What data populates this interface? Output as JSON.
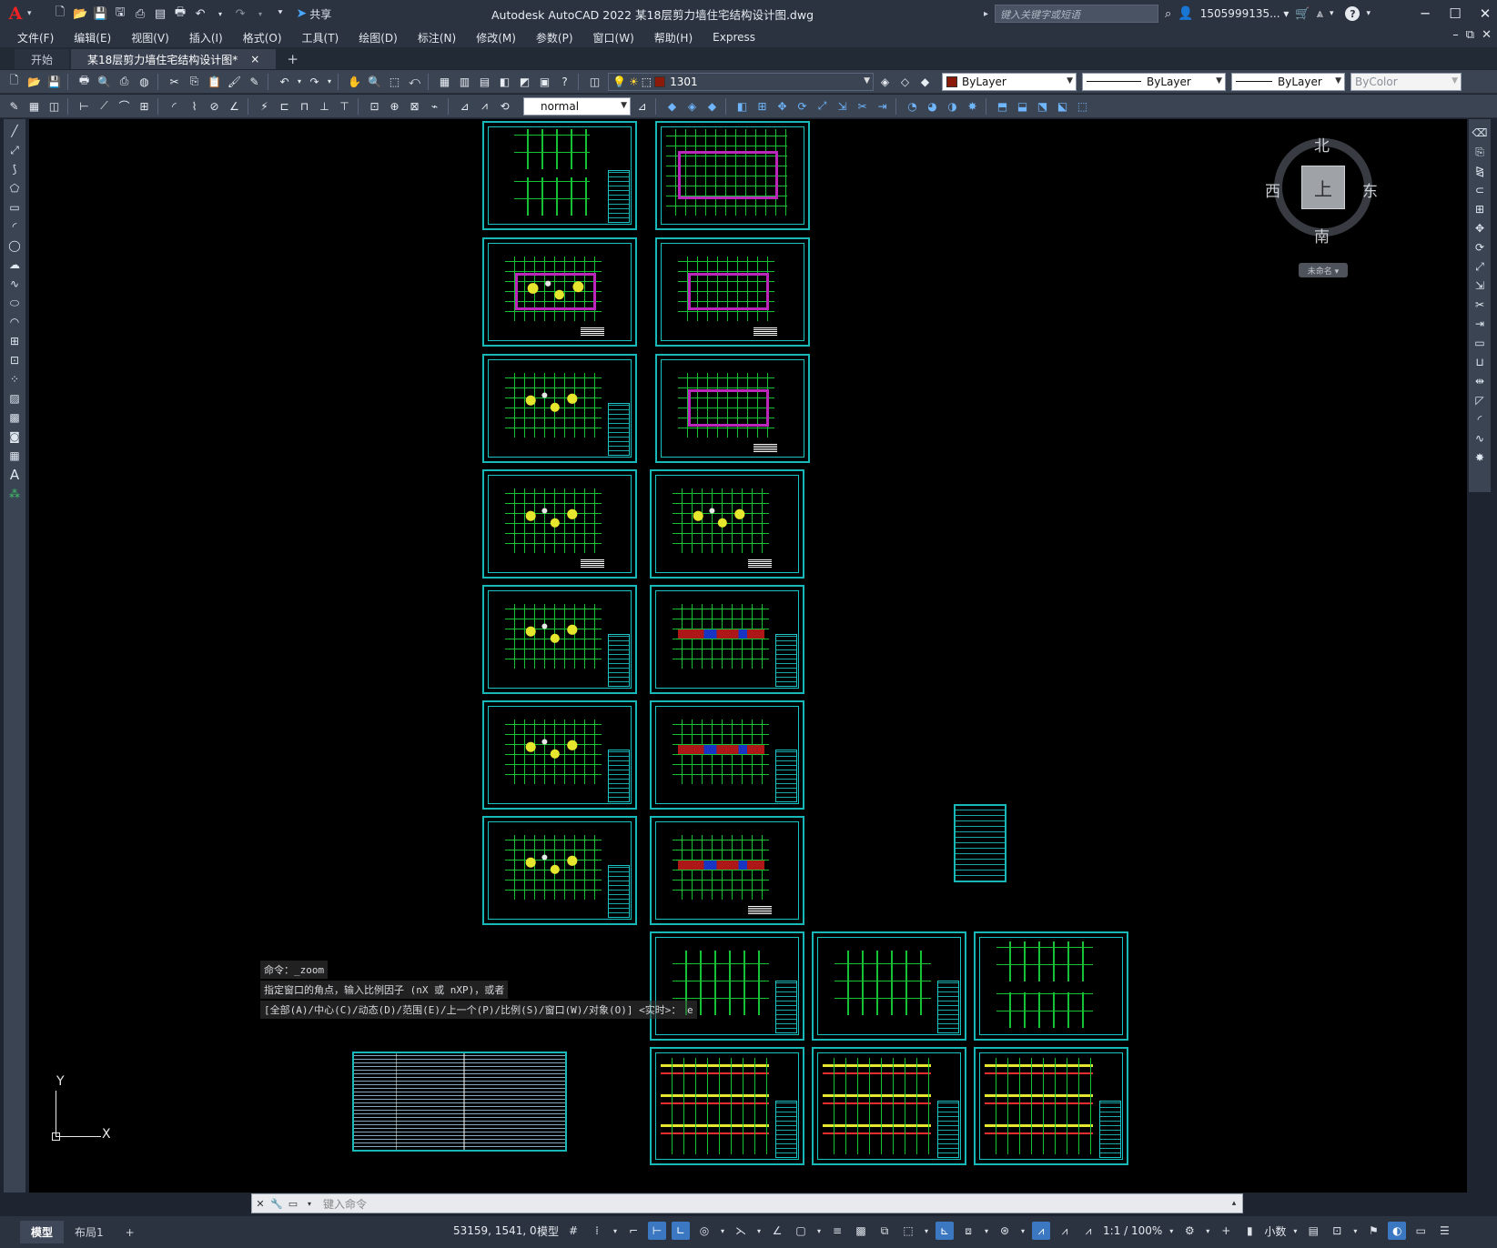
{
  "app": {
    "title": "Autodesk AutoCAD 2022    某18层剪力墙住宅结构设计图.dwg",
    "logo": "A",
    "share_label": "共享",
    "search_placeholder": "键入关键字或短语",
    "user": "1505999135... ▾",
    "help": "?"
  },
  "menu": [
    "文件(F)",
    "编辑(E)",
    "视图(V)",
    "插入(I)",
    "格式(O)",
    "工具(T)",
    "绘图(D)",
    "标注(N)",
    "修改(M)",
    "参数(P)",
    "窗口(W)",
    "帮助(H)",
    "Express"
  ],
  "tabs": {
    "start": "开始",
    "doc": "某18层剪力墙住宅结构设计图*",
    "close": "×",
    "add": "+"
  },
  "toolbar": {
    "layer_value": "1301",
    "layer_color": "#8b1a0a",
    "color_value": "ByLayer",
    "linetype_value": "ByLayer",
    "lineweight_value": "ByLayer",
    "plotstyle_value": "ByColor",
    "textstyle_value": "normal"
  },
  "viewcube": {
    "north": "北",
    "south": "南",
    "east": "东",
    "west": "西",
    "top": "上",
    "wcs": "未命名 ▾"
  },
  "ucs": {
    "x": "X",
    "y": "Y"
  },
  "command": {
    "history": [
      "命令：_zoom",
      "指定窗口的角点，输入比例因子 (nX 或 nXP)，或者",
      "[全部(A)/中心(C)/动态(D)/范围(E)/上一个(P)/比例(S)/窗口(W)/对象(O)] <实时>： e"
    ],
    "placeholder": "键入命令"
  },
  "status": {
    "model_tab": "模型",
    "layout_tab": "布局1",
    "add_layout": "+",
    "coords": "53159, 1541, 0",
    "space": "模型",
    "scale": "1:1 / 100%",
    "units": "小数"
  },
  "colors": {
    "sheet_border": "#19b8b8",
    "grid_green": "#19d63a",
    "canvas": "#000000"
  }
}
